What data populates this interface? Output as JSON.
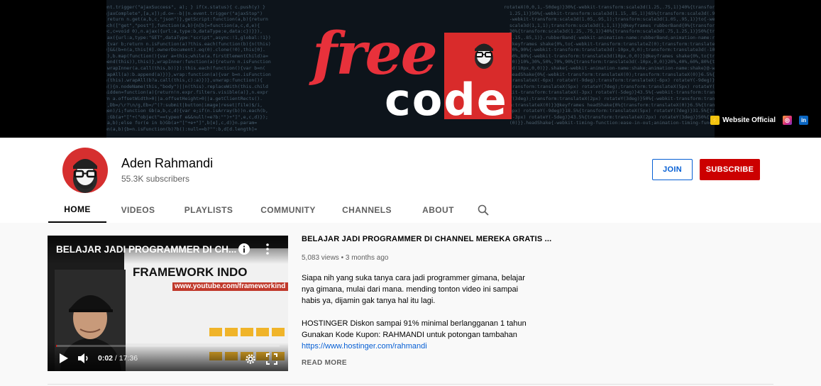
{
  "banner": {
    "logo_free": "free",
    "logo_code": "code",
    "links": [
      {
        "label": "Website Official",
        "icon": "website-icon"
      },
      {
        "label": "",
        "icon": "instagram-icon"
      },
      {
        "label": "",
        "icon": "linkedin-icon"
      }
    ]
  },
  "channel": {
    "name": "Aden Rahmandi",
    "subscribers": "55.3K subscribers",
    "join_label": "JOIN",
    "subscribe_label": "SUBSCRIBE",
    "tabs": [
      {
        "label": "HOME",
        "active": true
      },
      {
        "label": "VIDEOS"
      },
      {
        "label": "PLAYLISTS"
      },
      {
        "label": "COMMUNITY"
      },
      {
        "label": "CHANNELS"
      },
      {
        "label": "ABOUT"
      }
    ]
  },
  "featured": {
    "player_title": "BELAJAR JADI PROGRAMMER DI CH...",
    "screen_heading": "FRAMEWORK INDO",
    "screen_url": "www.youtube.com/frameworkind",
    "current_time": "0:02",
    "duration": "17:36",
    "progress": 0.002,
    "title": "BELAJAR JADI PROGRAMMER DI CHANNEL MEREKA GRATIS ...",
    "meta": "5,083 views • 3 months ago",
    "desc_p1": "Siapa nih yang suka tanya cara jadi programmer gimana, belajar nya gimana, mulai dari mana. mending tonton video ini sampai habis ya, dijamin gak tanya hal itu lagi.",
    "desc_p2_line1": "HOSTINGER Diskon sampai 91% minimal berlangganan 1 tahun",
    "desc_p2_line2": "Gunakan Kode Kupon: RAHMANDI untuk potongan tambahan",
    "desc_link": "https://www.hostinger.com/rahmandi",
    "read_more": "READ MORE"
  },
  "colors": {
    "brand_red": "#cc0000",
    "link_blue": "#065fd4",
    "logo_red": "#e8313b"
  }
}
